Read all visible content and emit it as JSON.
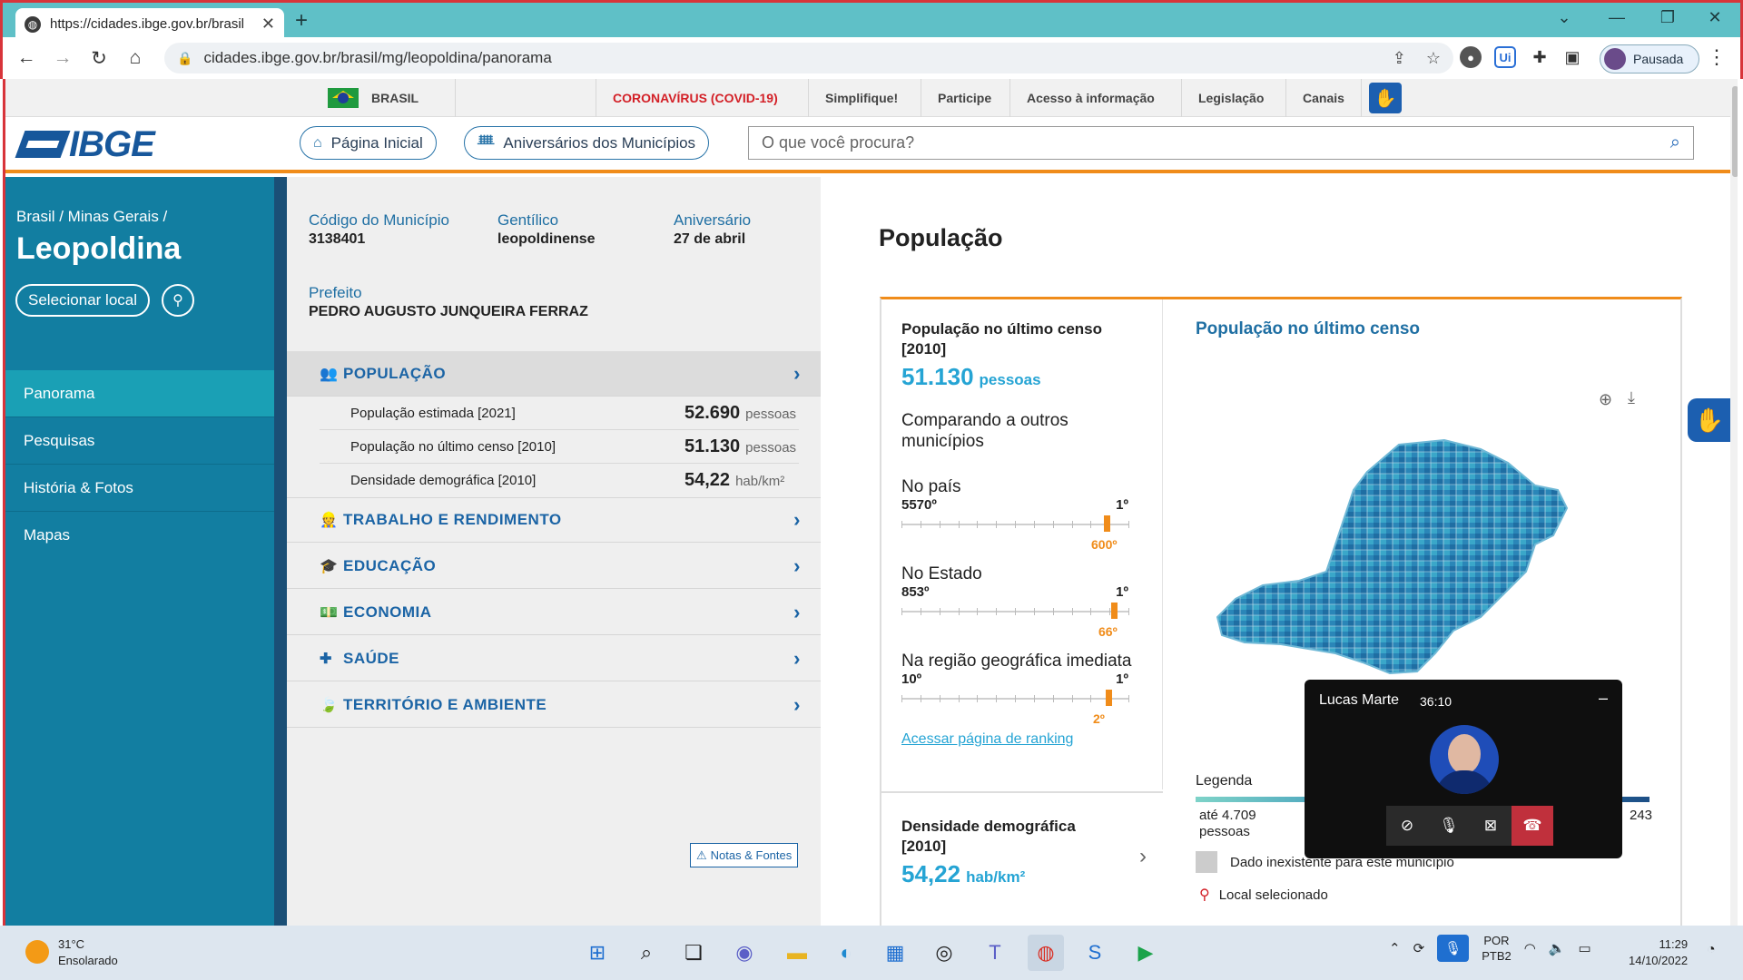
{
  "browser": {
    "tab_title": "https://cidades.ibge.gov.br/brasil",
    "url": "cidades.ibge.gov.br/brasil/mg/leopoldina/panorama",
    "profile_label": "Pausada"
  },
  "govbar": {
    "brasil": "BRASIL",
    "links": [
      "CORONAVÍRUS (COVID-19)",
      "Simplifique!",
      "Participe",
      "Acesso à informação",
      "Legislação",
      "Canais"
    ]
  },
  "header": {
    "logo": "IBGE",
    "home": "Página Inicial",
    "birthdays": "Aniversários dos Municípios",
    "search_placeholder": "O que você procura?"
  },
  "sidebar": {
    "breadcrumb": "Brasil / Minas Gerais /",
    "city": "Leopoldina",
    "select_local": "Selecionar local",
    "items": [
      "Panorama",
      "Pesquisas",
      "História & Fotos",
      "Mapas"
    ]
  },
  "meta": {
    "codigo_label": "Código do Município",
    "codigo": "3138401",
    "gentilico_label": "Gentílico",
    "gentilico": "leopoldinense",
    "aniversario_label": "Aniversário",
    "aniversario": "27 de abril",
    "prefeito_label": "Prefeito",
    "prefeito": "PEDRO AUGUSTO JUNQUEIRA FERRAZ"
  },
  "categories": {
    "populacao": "POPULAÇÃO",
    "trabalho": "TRABALHO E RENDIMENTO",
    "educacao": "EDUCAÇÃO",
    "economia": "ECONOMIA",
    "saude": "SAÚDE",
    "territorio": "TERRITÓRIO E AMBIENTE"
  },
  "populacao_rows": [
    {
      "label": "População estimada [2021]",
      "value": "52.690",
      "unit": "pessoas"
    },
    {
      "label": "População no último censo [2010]",
      "value": "51.130",
      "unit": "pessoas"
    },
    {
      "label": "Densidade demográfica [2010]",
      "value": "54,22",
      "unit": "hab/km²"
    }
  ],
  "notas": "Notas & Fontes",
  "panel": {
    "heading": "População",
    "censo_label": "População no último censo [2010]",
    "censo_value": "51.130",
    "censo_unit": "pessoas",
    "comparando": "Comparando a outros municípios",
    "rankings": [
      {
        "title": "No país",
        "low": "5570º",
        "high": "1º",
        "pos": "600º",
        "frac": 0.892
      },
      {
        "title": "No Estado",
        "low": "853º",
        "high": "1º",
        "pos": "66º",
        "frac": 0.924
      },
      {
        "title": "Na região geográfica imediata",
        "low": "10º",
        "high": "1º",
        "pos": "2º",
        "frac": 0.9
      }
    ],
    "ranking_link": "Acessar página de ranking",
    "densidade_label": "Densidade demográfica [2010]",
    "densidade_value": "54,22",
    "densidade_unit": "hab/km²",
    "map_title": "População no último censo",
    "legend_label": "Legenda",
    "legend_min": "até 4.709",
    "legend_min_unit": "pessoas",
    "legend_max": "243",
    "legend_missing": "Dado inexistente para este município",
    "legend_selected": "Local selecionado"
  },
  "call": {
    "name": "Lucas Marte",
    "time": "36:10"
  },
  "taskbar": {
    "temp": "31°C",
    "weather": "Ensolarado",
    "lang1": "POR",
    "lang2": "PTB2",
    "time": "11:29",
    "date": "14/10/2022"
  },
  "colors": {
    "ibge_blue": "#17579b",
    "sidebar": "#127ea1",
    "accent_orange": "#f08c1a",
    "value_blue": "#25a4d4",
    "covid_red": "#d31f26"
  }
}
